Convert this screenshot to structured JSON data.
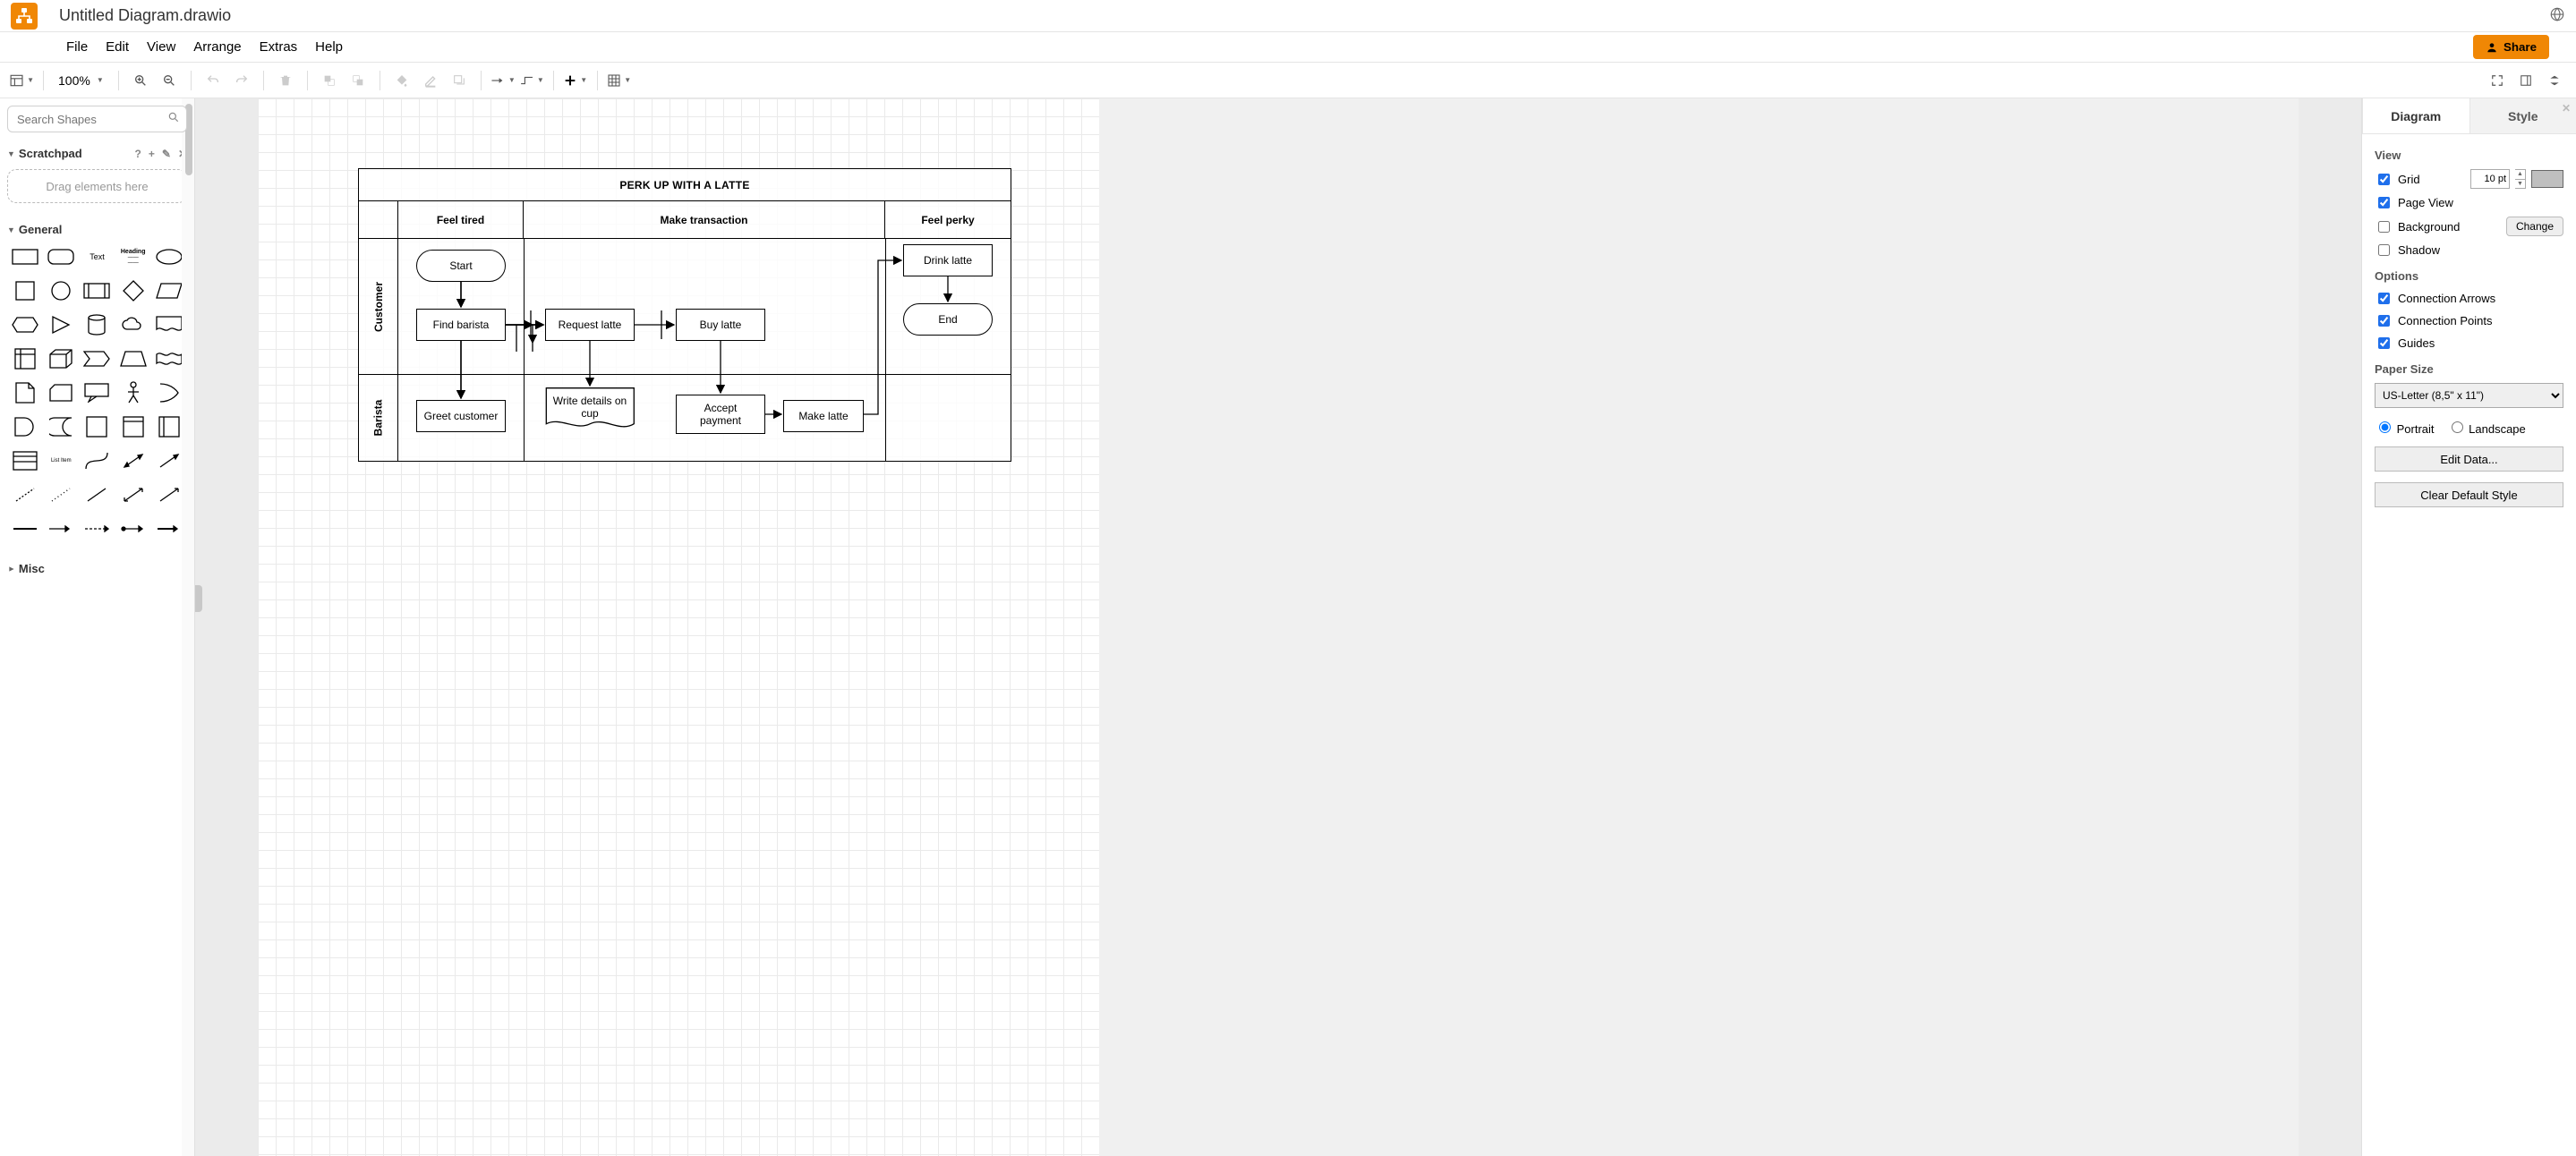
{
  "app": {
    "doc_title": "Untitled Diagram.drawio"
  },
  "menu": {
    "file": "File",
    "edit": "Edit",
    "view": "View",
    "arrange": "Arrange",
    "extras": "Extras",
    "help": "Help",
    "share": "Share"
  },
  "toolbar": {
    "zoom": "100%"
  },
  "sidebar": {
    "search_placeholder": "Search Shapes",
    "scratchpad": "Scratchpad",
    "dropzone": "Drag elements here",
    "general": "General",
    "misc": "Misc",
    "shape_text": "Text",
    "shape_heading": "Heading",
    "shape_listitem": "List Item"
  },
  "diagram": {
    "title": "PERK UP WITH A LATTE",
    "milestones": [
      "Feel tired",
      "Make transaction",
      "Feel perky"
    ],
    "swimlanes": [
      "Customer",
      "Barista"
    ],
    "nodes": {
      "start": "Start",
      "find_barista": "Find barista",
      "greet_customer": "Greet customer",
      "request_latte": "Request latte",
      "write_details": "Write details on cup",
      "buy_latte": "Buy latte",
      "accept_payment": "Accept payment",
      "make_latte": "Make latte",
      "drink_latte": "Drink latte",
      "end": "End"
    }
  },
  "panel": {
    "tab_diagram": "Diagram",
    "tab_style": "Style",
    "view": "View",
    "grid": "Grid",
    "grid_size": "10 pt",
    "page_view": "Page View",
    "background": "Background",
    "change": "Change",
    "shadow": "Shadow",
    "options": "Options",
    "conn_arrows": "Connection Arrows",
    "conn_points": "Connection Points",
    "guides": "Guides",
    "paper_size": "Paper Size",
    "paper": "US-Letter (8,5\" x 11\")",
    "portrait": "Portrait",
    "landscape": "Landscape",
    "edit_data": "Edit Data...",
    "clear_style": "Clear Default Style"
  },
  "chart_data": {
    "type": "swimlane-flowchart",
    "title": "PERK UP WITH A LATTE",
    "milestones": [
      "Feel tired",
      "Make transaction",
      "Feel perky"
    ],
    "swimlanes": [
      "Customer",
      "Barista"
    ],
    "nodes": [
      {
        "id": "start",
        "label": "Start",
        "lane": "Customer",
        "milestone": "Feel tired",
        "shape": "terminator"
      },
      {
        "id": "find_barista",
        "label": "Find barista",
        "lane": "Customer",
        "milestone": "Feel tired",
        "shape": "process"
      },
      {
        "id": "greet_customer",
        "label": "Greet customer",
        "lane": "Barista",
        "milestone": "Feel tired",
        "shape": "process"
      },
      {
        "id": "request_latte",
        "label": "Request latte",
        "lane": "Customer",
        "milestone": "Make transaction",
        "shape": "process"
      },
      {
        "id": "write_details",
        "label": "Write details on cup",
        "lane": "Barista",
        "milestone": "Make transaction",
        "shape": "document"
      },
      {
        "id": "buy_latte",
        "label": "Buy latte",
        "lane": "Customer",
        "milestone": "Make transaction",
        "shape": "process"
      },
      {
        "id": "accept_payment",
        "label": "Accept payment",
        "lane": "Barista",
        "milestone": "Make transaction",
        "shape": "process"
      },
      {
        "id": "make_latte",
        "label": "Make latte",
        "lane": "Barista",
        "milestone": "Make transaction",
        "shape": "process"
      },
      {
        "id": "drink_latte",
        "label": "Drink latte",
        "lane": "Customer",
        "milestone": "Feel perky",
        "shape": "process"
      },
      {
        "id": "end",
        "label": "End",
        "lane": "Customer",
        "milestone": "Feel perky",
        "shape": "terminator"
      }
    ],
    "edges": [
      [
        "start",
        "find_barista"
      ],
      [
        "find_barista",
        "greet_customer"
      ],
      [
        "find_barista",
        "request_latte"
      ],
      [
        "request_latte",
        "write_details"
      ],
      [
        "request_latte",
        "buy_latte"
      ],
      [
        "buy_latte",
        "accept_payment"
      ],
      [
        "accept_payment",
        "make_latte"
      ],
      [
        "make_latte",
        "drink_latte"
      ],
      [
        "drink_latte",
        "end"
      ]
    ]
  }
}
